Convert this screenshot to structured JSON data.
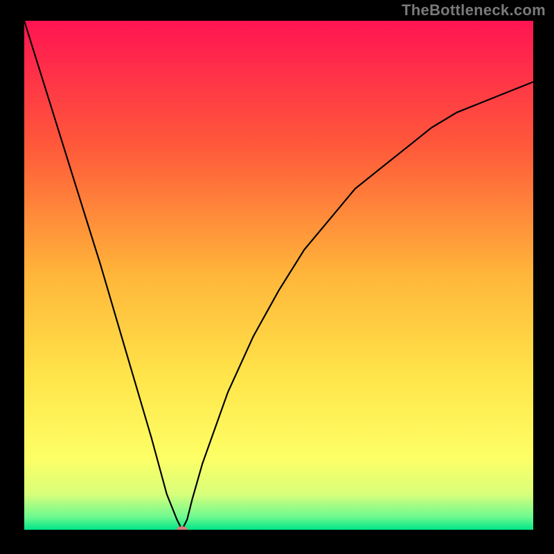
{
  "watermark": "TheBottleneck.com",
  "chart_data": {
    "type": "line",
    "title": "",
    "xlabel": "",
    "ylabel": "",
    "xlim": [
      0,
      100
    ],
    "ylim": [
      0,
      100
    ],
    "grid": false,
    "legend": false,
    "background_gradient": {
      "stops": [
        {
          "offset": 0.0,
          "color": "#ff1452"
        },
        {
          "offset": 0.25,
          "color": "#ff5a3a"
        },
        {
          "offset": 0.5,
          "color": "#ffb63a"
        },
        {
          "offset": 0.7,
          "color": "#ffe54a"
        },
        {
          "offset": 0.86,
          "color": "#fdff66"
        },
        {
          "offset": 0.93,
          "color": "#d8ff7a"
        },
        {
          "offset": 0.975,
          "color": "#6cf98f"
        },
        {
          "offset": 1.0,
          "color": "#00e588"
        }
      ]
    },
    "series": [
      {
        "name": "bottleneck-curve",
        "color": "#000000",
        "x": [
          0,
          5,
          10,
          15,
          20,
          25,
          28,
          30,
          31,
          32,
          33,
          35,
          40,
          45,
          50,
          55,
          60,
          65,
          70,
          75,
          80,
          85,
          90,
          95,
          100
        ],
        "y": [
          100,
          84,
          68,
          52,
          35,
          18,
          7,
          2,
          0,
          2,
          6,
          13,
          27,
          38,
          47,
          55,
          61,
          67,
          71,
          75,
          79,
          82,
          84,
          86,
          88
        ]
      }
    ],
    "marker": {
      "name": "bottleneck-min-marker",
      "x": 31,
      "y": 0,
      "color": "#d47a7a",
      "rx": 8,
      "ry": 5
    }
  }
}
